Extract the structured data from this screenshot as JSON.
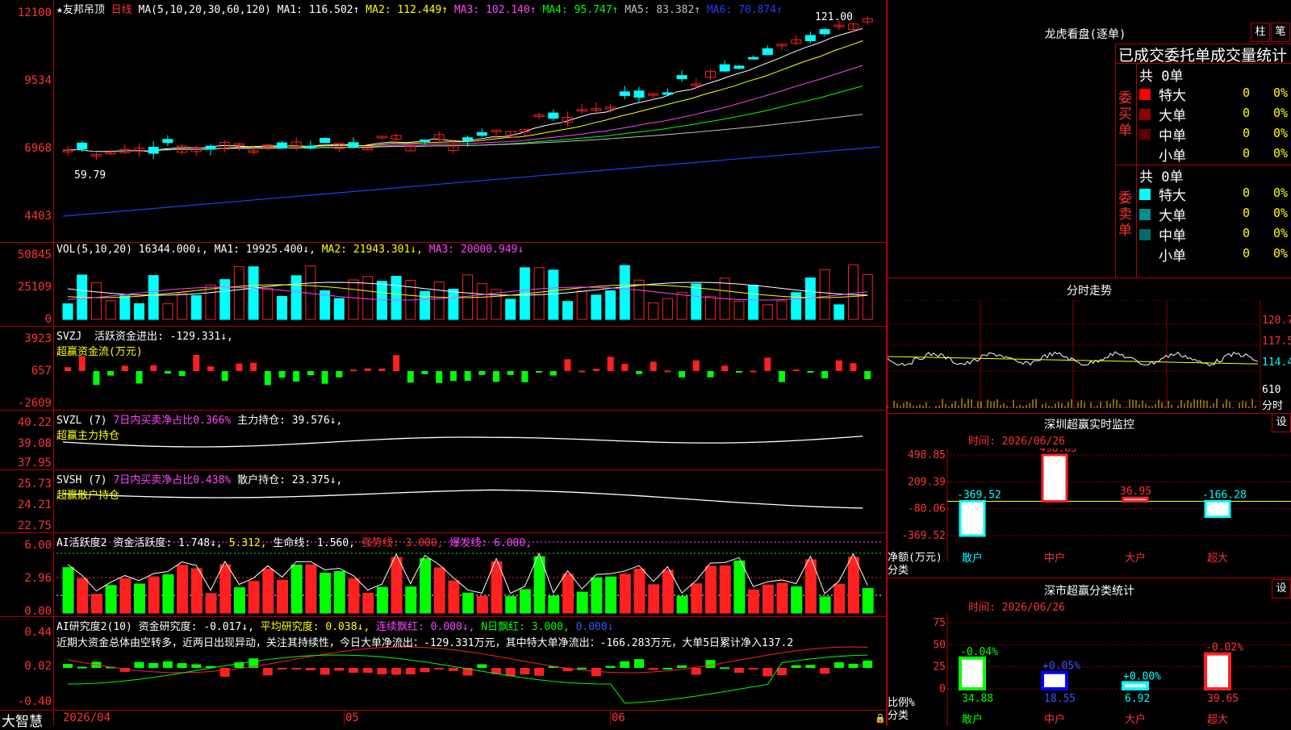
{
  "app": {
    "brand": "大智慧"
  },
  "kline": {
    "stock_name": "友邦吊顶",
    "period": "日线",
    "ma_label": "MA(5,10,20,30,60,120)",
    "ma1": "MA1: 116.502↑",
    "ma2": "MA2: 112.449↑",
    "ma3": "MA3: 102.140↑",
    "ma4": "MA4: 95.747↑",
    "ma5": "MA5: 83.382↑",
    "ma6": "MA6: 70.874↑",
    "high_mark": "121.00",
    "low_mark": "59.79",
    "y_ticks": [
      "12100",
      "9534",
      "6968",
      "4403"
    ],
    "colors": {
      "ma1": "#ffffff",
      "ma2": "#ffff00",
      "ma3": "#ff44ff",
      "ma4": "#00ff00",
      "ma5": "#c0c0c0",
      "ma6": "#1f3fff",
      "up": "#ff2020",
      "down": "#00ffff"
    }
  },
  "vol": {
    "label": "VOL(5,10,20)",
    "value": "16344.000↓,",
    "ma1": "MA1: 19925.400↓,",
    "ma2": "MA2: 21943.301↓,",
    "ma3": "MA3: 20000.949↓",
    "y_ticks": [
      "50845",
      "25109",
      "0"
    ]
  },
  "svzj": {
    "label": "SVZJ",
    "text1": "活跃资金进出: -129.331↓,",
    "text2": "超赢资金流(万元)",
    "y_ticks": [
      "3923",
      "657",
      "-2609"
    ]
  },
  "svzl": {
    "label": "SVZL (7)",
    "text1": "7日内买卖净占比0.366%",
    "text2": "主力持仓: 39.576↓,",
    "text3": "超赢主力持仓",
    "y_ticks": [
      "40.22",
      "39.08",
      "37.95"
    ]
  },
  "svsh": {
    "label": "SVSH (7)",
    "text1": "7日内买卖净占比0.438%",
    "text2": "散户持仓: 23.375↓,",
    "text3": "超赢散户持仓",
    "y_ticks": [
      "25.73",
      "24.21",
      "22.75"
    ]
  },
  "ai_active": {
    "label": "AI活跃度2",
    "t1": "资金活跃度: 1.748↓,",
    "t2": "5.312,",
    "t3": "生命线: 1.560,",
    "t4": "强势线: 3.000,",
    "t5": "爆发线: 6.000,",
    "y_ticks": [
      "6.00",
      "2.96",
      "0.00"
    ]
  },
  "ai_research": {
    "label": "AI研究度2(10)",
    "t1": "资金研究度: -0.017↓,",
    "t2": "平均研究度: 0.038↓,",
    "t3": "连续飘红: 0.000↓,",
    "t4": "N日飘红: 3.000,",
    "t5": "0.000↓",
    "comment": "近期大资金总体由空转多，近两日出现异动，关注其持续性，今日大单净流出：-129.331万元，其中特大单净流出：-166.283万元，大单5日累计净入137.2",
    "y_ticks": [
      "0.44",
      "0.02",
      "-0.40"
    ]
  },
  "x_axis": [
    "2026/04",
    "05",
    "06"
  ],
  "dragon_tiger": {
    "title": "龙虎看盘(逐单)",
    "tab1": "柱",
    "tab2": "笔",
    "header": "已成交委托单成交量统计",
    "buy_label": "委买单",
    "sell_label": "委卖单",
    "buy_total": "共 0单",
    "sell_total": "共 0单",
    "buy_rows": [
      {
        "name": "特大",
        "count": "0",
        "pct": "0%",
        "color": "#ff0000"
      },
      {
        "name": "大单",
        "count": "0",
        "pct": "0%",
        "color": "#8b0000"
      },
      {
        "name": "中单",
        "count": "0",
        "pct": "0%",
        "color": "#5a0000"
      },
      {
        "name": "小单",
        "count": "0",
        "pct": "0%",
        "color": "#000000"
      }
    ],
    "sell_rows": [
      {
        "name": "特大",
        "count": "0",
        "pct": "0%",
        "color": "#00ffff"
      },
      {
        "name": "大单",
        "count": "0",
        "pct": "0%",
        "color": "#009090"
      },
      {
        "name": "中单",
        "count": "0",
        "pct": "0%",
        "color": "#006a6a"
      },
      {
        "name": "小单",
        "count": "0",
        "pct": "0%",
        "color": "#000000"
      }
    ]
  },
  "intraday": {
    "title": "分时走势",
    "y_ticks": [
      "120.7",
      "117.5",
      "114.4",
      "610"
    ],
    "unit": "分时"
  },
  "monitor": {
    "title": "深圳超赢实时监控",
    "set": "设",
    "time": "时间: 2026/06/26",
    "y_ticks": [
      "498.85",
      "209.39",
      "-80.06",
      "-369.52"
    ],
    "ylabel1": "净额(万元)",
    "ylabel2": "分类",
    "categories": [
      "散户",
      "中户",
      "大户",
      "超大"
    ],
    "values_label": [
      "-369.52",
      "498.85",
      "36.95",
      "-166.28"
    ]
  },
  "classify": {
    "title": "深市超赢分类统计",
    "set": "设",
    "time": "时间: 2026/06/26",
    "y_ticks": [
      "75",
      "50",
      "25",
      "0"
    ],
    "ylabel1": "比例%",
    "ylabel2": "分类",
    "categories": [
      "散户",
      "中户",
      "大户",
      "超大"
    ],
    "change_labels": [
      "-0.04%",
      "+0.05%",
      "+0.00%",
      "-0.02%"
    ],
    "values_label": [
      "34.88",
      "18.55",
      "6.92",
      "39.65"
    ]
  },
  "chart_data": [
    {
      "type": "bar",
      "title": "深圳超赢实时监控",
      "ylabel": "净额(万元)",
      "categories": [
        "散户",
        "中户",
        "大户",
        "超大"
      ],
      "values": [
        -369.52,
        498.85,
        36.95,
        -166.28
      ],
      "ylim": [
        -369.52,
        498.85
      ]
    },
    {
      "type": "bar",
      "title": "深市超赢分类统计",
      "ylabel": "比例%",
      "categories": [
        "散户",
        "中户",
        "大户",
        "超大"
      ],
      "values": [
        34.88,
        18.55,
        6.92,
        39.65
      ],
      "ylim": [
        0,
        75
      ]
    }
  ]
}
